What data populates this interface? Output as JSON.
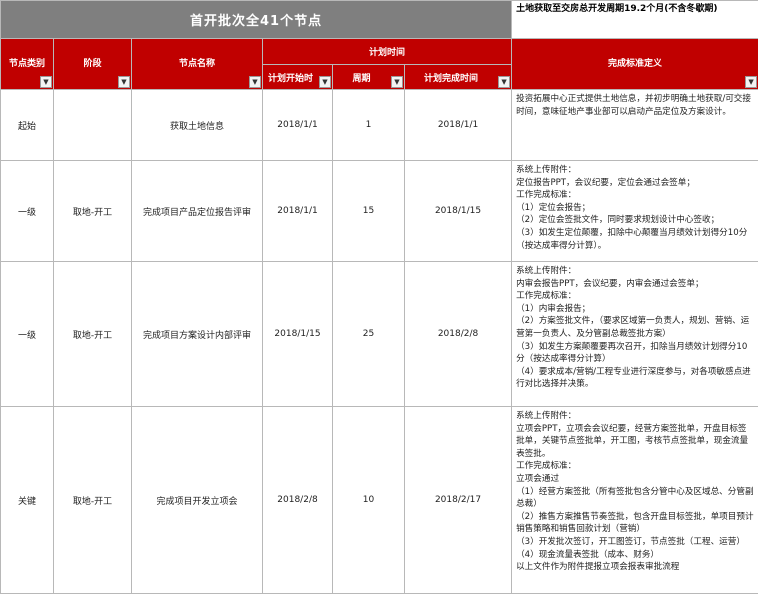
{
  "sheet": {
    "title": "首开批次全41个节点",
    "period_note": "土地获取至交房总开发周期19.2个月(不含冬歇期)"
  },
  "headers": {
    "node_type": "节点类别",
    "stage": "阶段",
    "node_name": "节点名称",
    "plan_time": "计划时间",
    "plan_start": "计划开始时",
    "duration": "周期",
    "plan_finish": "计划完成时间",
    "standard": "完成标准定义"
  },
  "rows": [
    {
      "node_type": "起始",
      "stage": "",
      "node_name": "获取土地信息",
      "plan_start": "2018/1/1",
      "duration": "1",
      "plan_finish": "2018/1/1",
      "standard": "投资拓展中心正式提供土地信息，并初步明确土地获取/可交接时间，意味征地产事业部可以启动产品定位及方案设计。"
    },
    {
      "node_type": "一级",
      "stage": "取地-开工",
      "node_name": "完成项目产品定位报告评审",
      "plan_start": "2018/1/1",
      "duration": "15",
      "plan_finish": "2018/1/15",
      "standard": "系统上传附件：\n定位报告PPT，会议纪要，定位会通过会签单；\n工作完成标准：\n（1）定位会报告；\n（2）定位会签批文件，同时要求规划设计中心签收；\n（3）如发生定位颠覆，扣除中心颠覆当月绩效计划得分10分（按达成率得分计算）。"
    },
    {
      "node_type": "一级",
      "stage": "取地-开工",
      "node_name": "完成项目方案设计内部评审",
      "plan_start": "2018/1/15",
      "duration": "25",
      "plan_finish": "2018/2/8",
      "standard": "系统上传附件：\n内审会报告PPT，会议纪要，内审会通过会签单；\n工作完成标准：\n（1）内审会报告；\n（2）方案签批文件，（要求区域第一负责人，规划、营销、运营第一负责人、及分管副总裁签批方案）\n（3）如发生方案颠覆要再次召开，扣除当月绩效计划得分10分（按达成率得分计算）\n（4）要求成本/营销/工程专业进行深度参与，对各项敏感点进行对比选择并决策。"
    },
    {
      "node_type": "关键",
      "stage": "取地-开工",
      "node_name": "完成项目开发立项会",
      "plan_start": "2018/2/8",
      "duration": "10",
      "plan_finish": "2018/2/17",
      "standard": "系统上传附件：\n立项会PPT，立项会会议纪要，经营方案签批单，开盘目标签批单，关键节点签批单，开工图，考核节点签批单，现金流量表签批。\n工作完成标准：\n立项会通过\n（1）经营方案签批（所有签批包含分管中心及区域总、分管副总裁）\n（2）推售方案推售节奏签批，包含开盘目标签批，单项目预计销售策略和销售回款计划（营销）\n（3）开发批次签订，开工图签订，节点签批（工程、运营）\n（4）现金流量表签批（成本、财务）\n以上文件作为附件提报立项会报表审批流程"
    }
  ]
}
